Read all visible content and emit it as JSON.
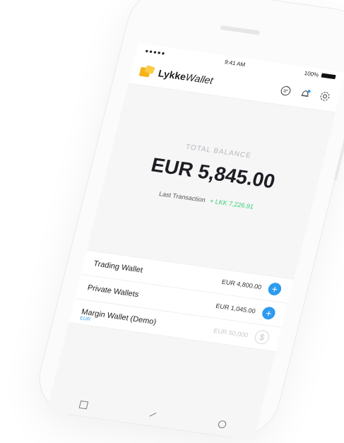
{
  "status": {
    "signal": "●●●●● ",
    "time": "9:41 AM",
    "battery": "100%"
  },
  "app": {
    "brand_bold": "Lykke",
    "brand_italic": "Wallet"
  },
  "balance": {
    "label": "TOTAL BALANCE",
    "value": "EUR 5,845.00",
    "last_label": "Last Transaction",
    "last_delta": "+ LKK 7,226.91"
  },
  "wallets": [
    {
      "name": "Trading Wallet",
      "amount": "EUR 4,800.00"
    },
    {
      "name": "Private Wallets",
      "amount": "EUR 1,045.00"
    },
    {
      "name": "Margin Wallet (Demo)",
      "sub": "EUR",
      "amount": "EUR 50,000"
    }
  ],
  "colors": {
    "accent": "#2d9bf0",
    "brand_yellow": "#f7b21b",
    "positive_green": "#2fcf6e"
  }
}
